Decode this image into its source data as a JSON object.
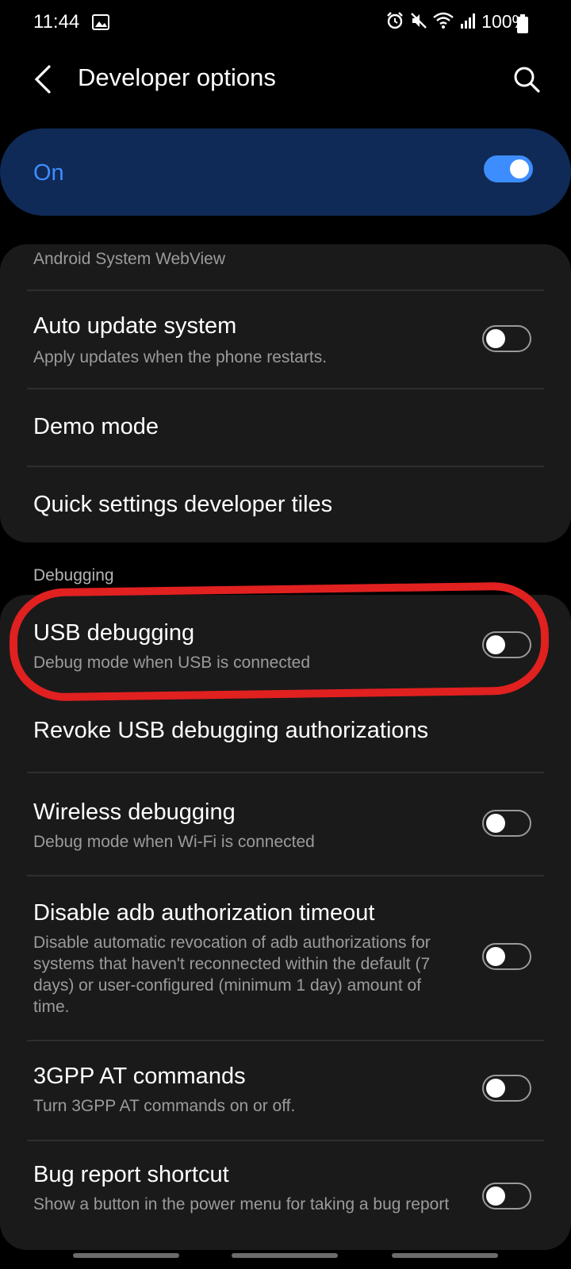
{
  "status_bar": {
    "time": "11:44",
    "battery": "100%"
  },
  "header": {
    "title": "Developer options"
  },
  "master_switch": {
    "label": "On",
    "enabled": true
  },
  "general": {
    "webview_value": "Android System WebView",
    "items": [
      {
        "title": "Auto update system",
        "subtitle": "Apply updates when the phone restarts.",
        "toggle": false
      },
      {
        "title": "Demo mode"
      },
      {
        "title": "Quick settings developer tiles"
      }
    ]
  },
  "debugging": {
    "section_label": "Debugging",
    "items": [
      {
        "title": "USB debugging",
        "subtitle": "Debug mode when USB is connected",
        "toggle": false
      },
      {
        "title": "Revoke USB debugging authorizations"
      },
      {
        "title": "Wireless debugging",
        "subtitle": "Debug mode when Wi-Fi is connected",
        "toggle": false
      },
      {
        "title": "Disable adb authorization timeout",
        "subtitle": "Disable automatic revocation of adb authorizations for systems that haven't reconnected within the default (7 days) or user-configured (minimum 1 day) amount of time.",
        "toggle": false
      },
      {
        "title": "3GPP AT commands",
        "subtitle": "Turn 3GPP AT commands on or off.",
        "toggle": false
      },
      {
        "title": "Bug report shortcut",
        "subtitle": "Show a button in the power menu for taking a bug report",
        "toggle": false
      }
    ]
  },
  "colors": {
    "accent": "#3e8dff",
    "annotation": "#e12020",
    "card": "#1a1a1a",
    "master_bg": "#0f2a56"
  },
  "icons": [
    "image-icon",
    "alarm-icon",
    "mute-icon",
    "wifi-icon",
    "signal-icon",
    "battery-icon",
    "back-icon",
    "search-icon"
  ]
}
